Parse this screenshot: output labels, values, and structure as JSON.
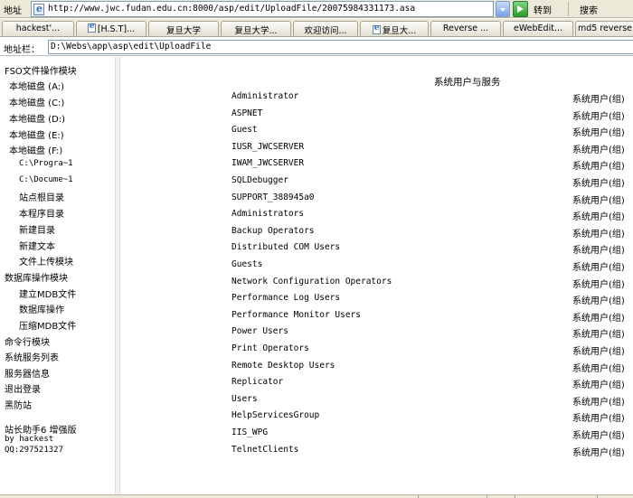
{
  "browser": {
    "address_label": "地址",
    "url": "http://www.jwc.fudan.edu.cn:8000/asp/edit/UploadFile/20075984331173.asa",
    "go_label": "转到",
    "search_label": "搜索"
  },
  "tabs": [
    {
      "label": "hackest'..."
    },
    {
      "label": "[H.S.T]..."
    },
    {
      "label": "复旦大学"
    },
    {
      "label": "复旦大学..."
    },
    {
      "label": "欢迎访问..."
    },
    {
      "label": "复旦大..."
    },
    {
      "label": "Reverse ..."
    },
    {
      "label": "eWebEdit..."
    },
    {
      "label": "md5 reverse"
    }
  ],
  "address_row": {
    "label": "地址栏：",
    "value": "D:\\Webs\\app\\asp\\edit\\UploadFile"
  },
  "sidebar": {
    "items": [
      {
        "label": "FSO文件操作模块",
        "kind": "module"
      },
      {
        "label": "本地磁盘 (A:)",
        "kind": "disk"
      },
      {
        "label": "本地磁盘 (C:)",
        "kind": "disk"
      },
      {
        "label": "本地磁盘 (D:)",
        "kind": "disk"
      },
      {
        "label": "本地磁盘 (E:)",
        "kind": "disk"
      },
      {
        "label": "本地磁盘 (F:)",
        "kind": "disk"
      },
      {
        "label": "C:\\Progra~1",
        "kind": "path"
      },
      {
        "label": "C:\\Docume~1",
        "kind": "path"
      },
      {
        "label": "站点根目录",
        "kind": "sub"
      },
      {
        "label": "本程序目录",
        "kind": "sub"
      },
      {
        "label": "新建目录",
        "kind": "sub"
      },
      {
        "label": "新建文本",
        "kind": "sub"
      },
      {
        "label": "文件上传模块",
        "kind": "sub"
      },
      {
        "label": "数据库操作模块",
        "kind": "module"
      },
      {
        "label": "建立MDB文件",
        "kind": "sub"
      },
      {
        "label": "数据库操作",
        "kind": "sub"
      },
      {
        "label": "压缩MDB文件",
        "kind": "sub"
      },
      {
        "label": "命令行模块",
        "kind": "module"
      },
      {
        "label": "系统服务列表",
        "kind": "module"
      },
      {
        "label": "服务器信息",
        "kind": "module"
      },
      {
        "label": "退出登录",
        "kind": "module"
      },
      {
        "label": "黑防站",
        "kind": "module"
      }
    ],
    "footer": {
      "title": "站长助手6 增强版",
      "author": "by hackest",
      "qq": "QQ:297521327"
    }
  },
  "main": {
    "title": "系统用户与服务",
    "users": [
      {
        "name": "Administrator",
        "type": "系统用户(组)"
      },
      {
        "name": "ASPNET",
        "type": "系统用户(组)"
      },
      {
        "name": "Guest",
        "type": "系统用户(组)"
      },
      {
        "name": "IUSR_JWCSERVER",
        "type": "系统用户(组)"
      },
      {
        "name": "IWAM_JWCSERVER",
        "type": "系统用户(组)"
      },
      {
        "name": "SQLDebugger",
        "type": "系统用户(组)"
      },
      {
        "name": "SUPPORT_388945a0",
        "type": "系统用户(组)"
      },
      {
        "name": "Administrators",
        "type": "系统用户(组)"
      },
      {
        "name": "Backup Operators",
        "type": "系统用户(组)"
      },
      {
        "name": "Distributed COM Users",
        "type": "系统用户(组)"
      },
      {
        "name": "Guests",
        "type": "系统用户(组)"
      },
      {
        "name": "Network Configuration Operators",
        "type": "系统用户(组)"
      },
      {
        "name": "Performance Log Users",
        "type": "系统用户(组)"
      },
      {
        "name": "Performance Monitor Users",
        "type": "系统用户(组)"
      },
      {
        "name": "Power Users",
        "type": "系统用户(组)"
      },
      {
        "name": "Print Operators",
        "type": "系统用户(组)"
      },
      {
        "name": "Remote Desktop Users",
        "type": "系统用户(组)"
      },
      {
        "name": "Replicator",
        "type": "系统用户(组)"
      },
      {
        "name": "Users",
        "type": "系统用户(组)"
      },
      {
        "name": "HelpServicesGroup",
        "type": "系统用户(组)"
      },
      {
        "name": "IIS_WPG",
        "type": "系统用户(组)"
      },
      {
        "name": "TelnetClients",
        "type": "系统用户(组)"
      }
    ]
  }
}
